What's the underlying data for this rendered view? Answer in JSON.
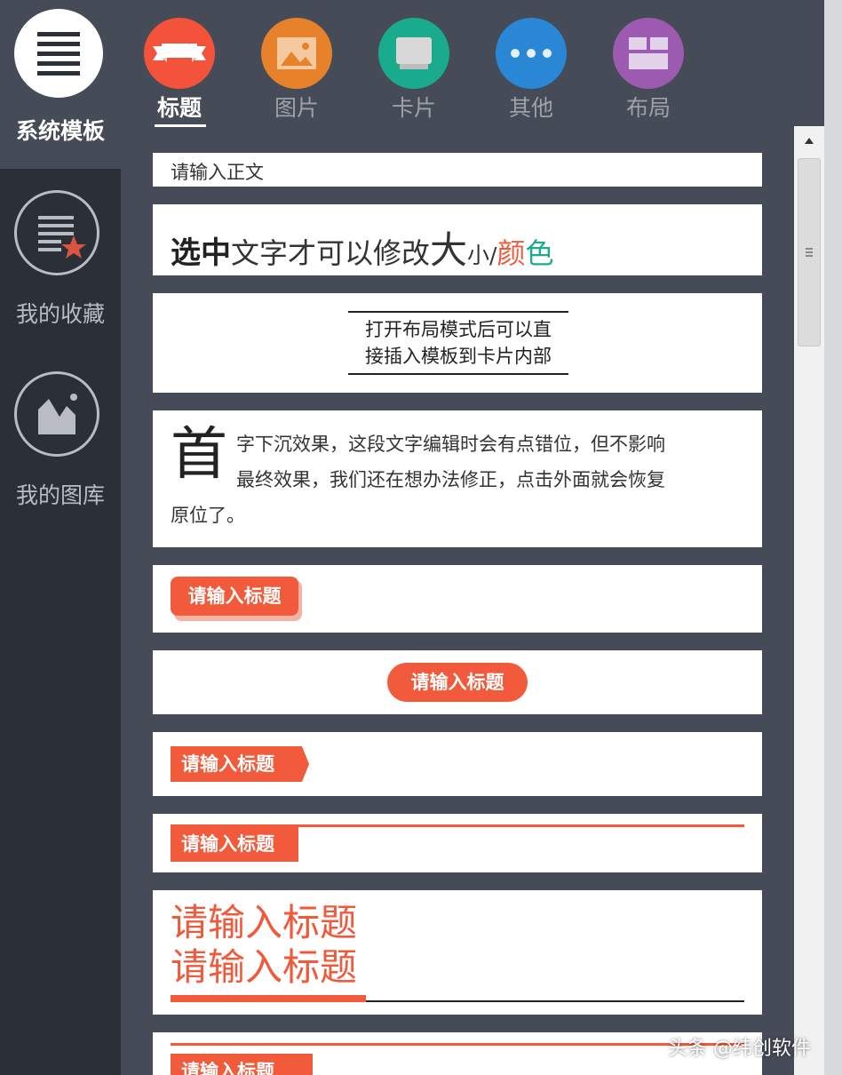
{
  "sidebar": {
    "system_label": "系统模板",
    "favorites_label": "我的收藏",
    "gallery_label": "我的图库"
  },
  "tabs": [
    {
      "label": "标题",
      "color": "#f2533a",
      "icon": "ribbon-icon",
      "active": true
    },
    {
      "label": "图片",
      "color": "#e8822a",
      "icon": "image-icon",
      "active": false
    },
    {
      "label": "卡片",
      "color": "#1aab8f",
      "icon": "card-icon",
      "active": false
    },
    {
      "label": "其他",
      "color": "#2a87d6",
      "icon": "more-icon",
      "active": false
    },
    {
      "label": "布局",
      "color": "#9c5bb0",
      "icon": "layout-icon",
      "active": false
    }
  ],
  "templates": {
    "body_text": "请输入正文",
    "style_line": {
      "bold": "选中",
      "normal": "文字才可以修改",
      "large": "大",
      "small": "小/",
      "red": "颜",
      "teal": "色"
    },
    "layout_hint_line1": "打开布局模式后可以直",
    "layout_hint_line2": "接插入模板到卡片内部",
    "dropcap_char": "首",
    "dropcap_line1": "字下沉效果，这段文字编辑时会有点错位，但不影响",
    "dropcap_line2": "最终效果，我们还在想办法修正，点击外面就会恢复",
    "dropcap_line3": "原位了。",
    "title_placeholder": "请输入标题",
    "big_title_line1": "请输入标题",
    "big_title_line2": "请输入标题"
  },
  "watermark": "头条 @纬创软件",
  "colors": {
    "accent": "#f15a3a",
    "teal": "#1aab8f",
    "sidebar": "#2b2f38",
    "background": "#454b57"
  }
}
